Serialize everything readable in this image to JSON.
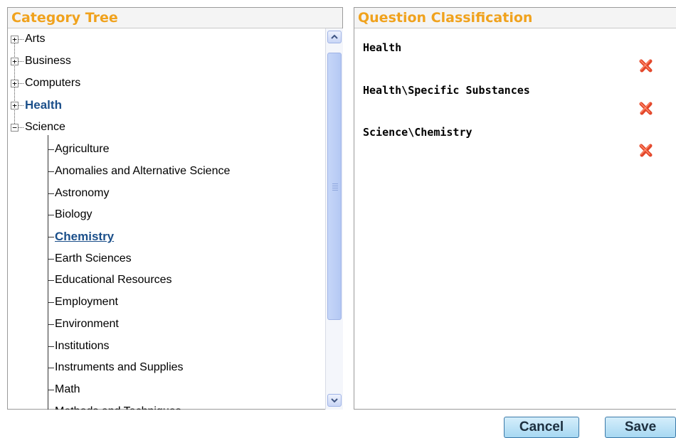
{
  "category_tree": {
    "title": "Category Tree",
    "top_level": [
      {
        "label": "Arts",
        "toggle": "+"
      },
      {
        "label": "Business",
        "toggle": "+"
      },
      {
        "label": "Computers",
        "toggle": "+"
      },
      {
        "label": "Health",
        "toggle": "+",
        "highlight": true
      },
      {
        "label": "Science",
        "toggle": "−",
        "expanded": true
      }
    ],
    "science_children": [
      {
        "label": "Agriculture"
      },
      {
        "label": "Anomalies and Alternative Science"
      },
      {
        "label": "Astronomy"
      },
      {
        "label": "Biology"
      },
      {
        "label": "Chemistry",
        "selected": true
      },
      {
        "label": "Earth Sciences"
      },
      {
        "label": "Educational Resources"
      },
      {
        "label": "Employment"
      },
      {
        "label": "Environment"
      },
      {
        "label": "Institutions"
      },
      {
        "label": "Instruments and Supplies"
      },
      {
        "label": "Math"
      },
      {
        "label": "Methods and Techniques"
      }
    ],
    "scroll_fraction": 0.0
  },
  "question_classification": {
    "title": "Question Classification",
    "items": [
      {
        "label": "Health"
      },
      {
        "label": "Health\\Specific Substances"
      },
      {
        "label": "Science\\Chemistry"
      }
    ]
  },
  "buttons": {
    "cancel": "Cancel",
    "save": "Save"
  },
  "colors": {
    "header_text": "#f0a21d",
    "link_blue": "#1b4f8a",
    "delete_red": "#e2462a"
  },
  "icons": {
    "expand": "plus-box",
    "collapse": "minus-box",
    "delete": "red-x",
    "scroll_up": "chevron-up",
    "scroll_down": "chevron-down"
  }
}
